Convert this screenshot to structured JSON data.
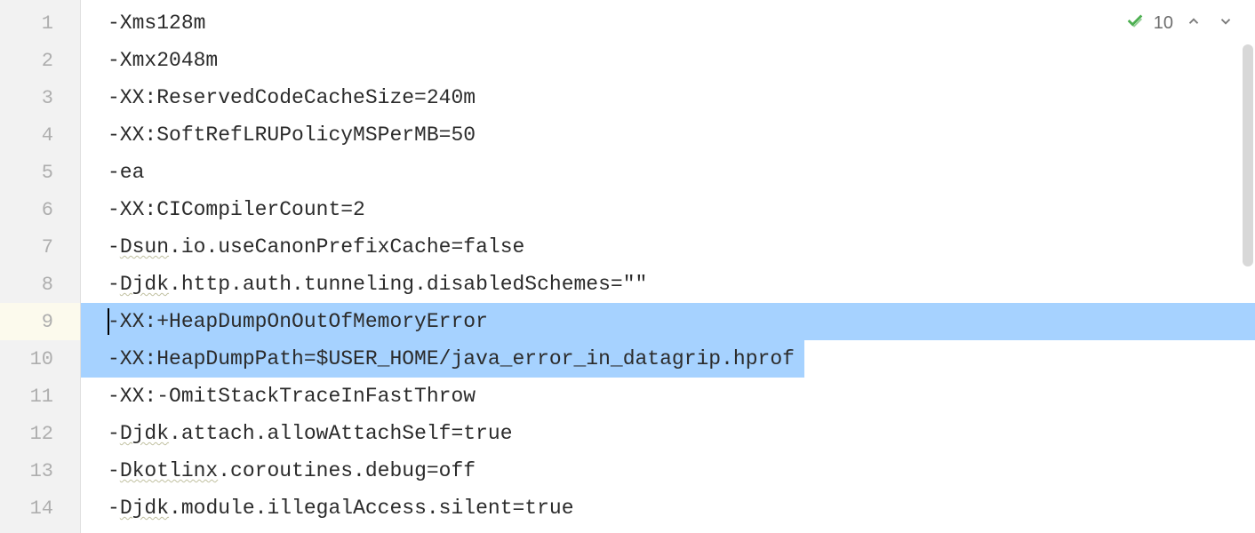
{
  "status": {
    "count": "10"
  },
  "lines": [
    {
      "num": "1",
      "text": "-Xms128m",
      "active": false,
      "selected": false
    },
    {
      "num": "2",
      "text": "-Xmx2048m",
      "active": false,
      "selected": false
    },
    {
      "num": "3",
      "text": "-XX:ReservedCodeCacheSize=240m",
      "active": false,
      "selected": false
    },
    {
      "num": "4",
      "text": "-XX:SoftRefLRUPolicyMSPerMB=50",
      "active": false,
      "selected": false
    },
    {
      "num": "5",
      "text": "-ea",
      "active": false,
      "selected": false
    },
    {
      "num": "6",
      "text": "-XX:CICompilerCount=2",
      "active": false,
      "selected": false
    },
    {
      "num": "7",
      "text": "-Dsun.io.useCanonPrefixCache=false",
      "active": false,
      "selected": false,
      "typo": "Dsun"
    },
    {
      "num": "8",
      "text": "-Djdk.http.auth.tunneling.disabledSchemes=\"\"",
      "active": false,
      "selected": false,
      "typo": "Djdk"
    },
    {
      "num": "9",
      "text": "-XX:+HeapDumpOnOutOfMemoryError",
      "active": true,
      "selected": "full"
    },
    {
      "num": "10",
      "text": "-XX:HeapDumpPath=$USER_HOME/java_error_in_datagrip.hprof",
      "active": false,
      "selected": "partial"
    },
    {
      "num": "11",
      "text": "-XX:-OmitStackTraceInFastThrow",
      "active": false,
      "selected": false
    },
    {
      "num": "12",
      "text": "-Djdk.attach.allowAttachSelf=true",
      "active": false,
      "selected": false,
      "typo": "Djdk"
    },
    {
      "num": "13",
      "text": "-Dkotlinx.coroutines.debug=off",
      "active": false,
      "selected": false,
      "typo": "Dkotlinx"
    },
    {
      "num": "14",
      "text": "-Djdk.module.illegalAccess.silent=true",
      "active": false,
      "selected": false,
      "typo": "Djdk"
    }
  ]
}
